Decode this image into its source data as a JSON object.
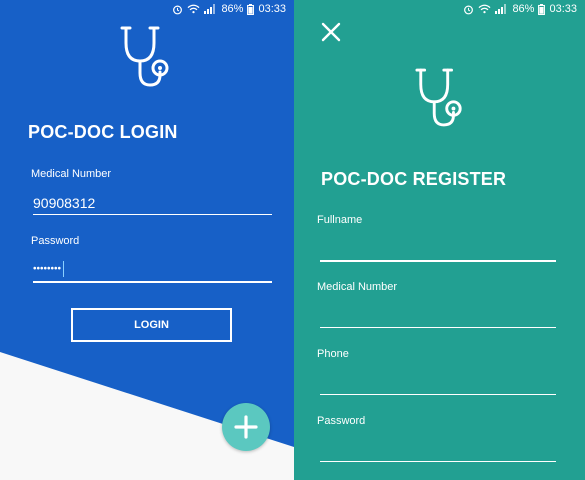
{
  "status_bar": {
    "battery": "86%",
    "time": "03:33"
  },
  "login": {
    "title": "POC-DOC LOGIN",
    "medical_number_label": "Medical Number",
    "medical_number_value": "90908312",
    "password_label": "Password",
    "password_value": "••••••••",
    "login_button": "LOGIN",
    "fab_icon": "plus-icon"
  },
  "register": {
    "close_icon": "close-icon",
    "title": "POC-DOC REGISTER",
    "fullname_label": "Fullname",
    "medical_number_label": "Medical Number",
    "phone_label": "Phone",
    "password_label": "Password"
  },
  "colors": {
    "login_bg": "#1760c7",
    "register_bg": "#22a092",
    "fab": "#5bc8c0"
  }
}
